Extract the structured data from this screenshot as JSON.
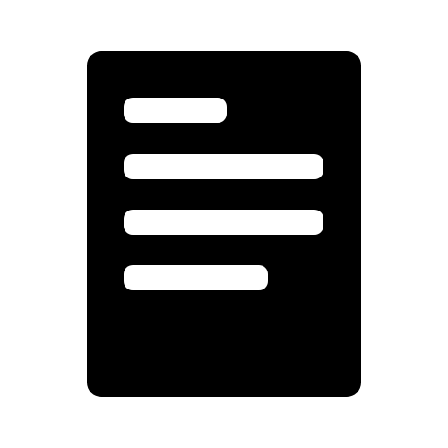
{
  "icon": {
    "name": "document-icon",
    "description_lines": 4
  },
  "colors": {
    "background": "#ffffff",
    "document_fill": "#000000",
    "line_fill": "#ffffff"
  }
}
